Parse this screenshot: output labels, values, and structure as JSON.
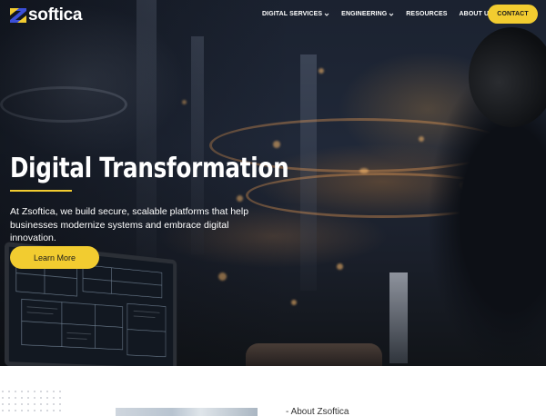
{
  "brand": {
    "name": "softica",
    "mark_letter": "Z",
    "accent": "#f2cc30",
    "mark_blue": "#3b4fd8"
  },
  "nav": {
    "items": [
      {
        "label": "DIGITAL SERVICES",
        "has_dropdown": true
      },
      {
        "label": "ENGINEERING",
        "has_dropdown": true
      },
      {
        "label": "RESOURCES",
        "has_dropdown": false
      },
      {
        "label": "ABOUT US",
        "has_dropdown": false
      }
    ],
    "search_icon": "search-icon",
    "contact_label": "CONTACT"
  },
  "hero": {
    "title": "Digital Transformation",
    "description": "At Zsoftica, we build secure, scalable platforms that help businesses modernize systems and embrace digital innovation.",
    "cta_label": "Learn More"
  },
  "about": {
    "label": "About Zsoftica"
  },
  "colors": {
    "text_light": "#ffffff",
    "button_text": "#1a1a1a"
  }
}
